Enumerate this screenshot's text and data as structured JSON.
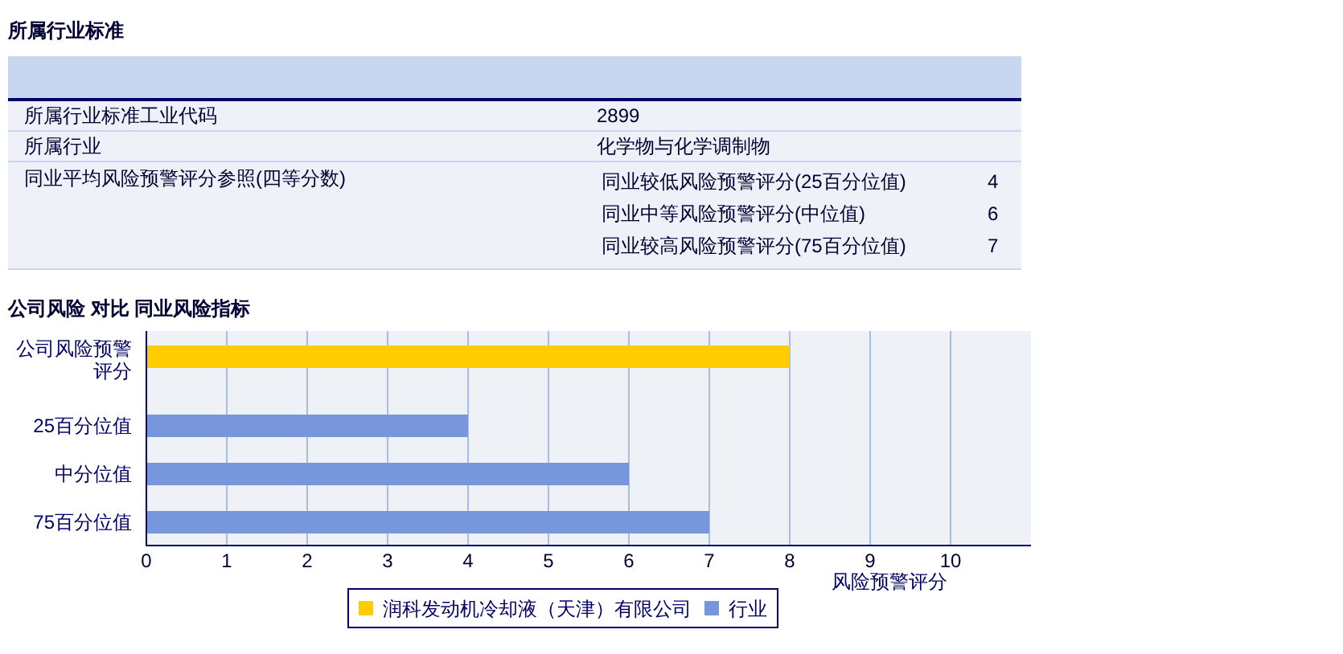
{
  "industry_section": {
    "title": "所属行业标准",
    "rows": [
      {
        "label": "所属行业标准工业代码",
        "value": "2899"
      },
      {
        "label": "所属行业",
        "value": "化学物与化学调制物"
      }
    ],
    "reference": {
      "label": "同业平均风险预警评分参照(四等分数)",
      "items": [
        {
          "label": "同业较低风险预警评分(25百分位值)",
          "value": "4"
        },
        {
          "label": "同业中等风险预警评分(中位值)",
          "value": "6"
        },
        {
          "label": "同业较高风险预警评分(75百分位值)",
          "value": "7"
        }
      ]
    }
  },
  "comparison_section": {
    "title": "公司风险  对比  同业风险指标",
    "chart_data": {
      "type": "bar",
      "orientation": "horizontal",
      "grid": true,
      "xlabel": "风险预警评分",
      "categories": [
        "公司风险预警评分",
        "25百分位值",
        "中分位值",
        "75百分位值"
      ],
      "series": [
        {
          "name": "润科发动机冷却液（天津）有限公司",
          "color": "#ffcc00",
          "values": [
            8,
            null,
            null,
            null
          ]
        },
        {
          "name": "行业",
          "color": "#7896dc",
          "values": [
            null,
            4,
            6,
            7
          ]
        }
      ],
      "xlim": [
        0,
        11
      ],
      "xticks": [
        0,
        1,
        2,
        3,
        4,
        5,
        6,
        7,
        8,
        9,
        10
      ]
    }
  }
}
